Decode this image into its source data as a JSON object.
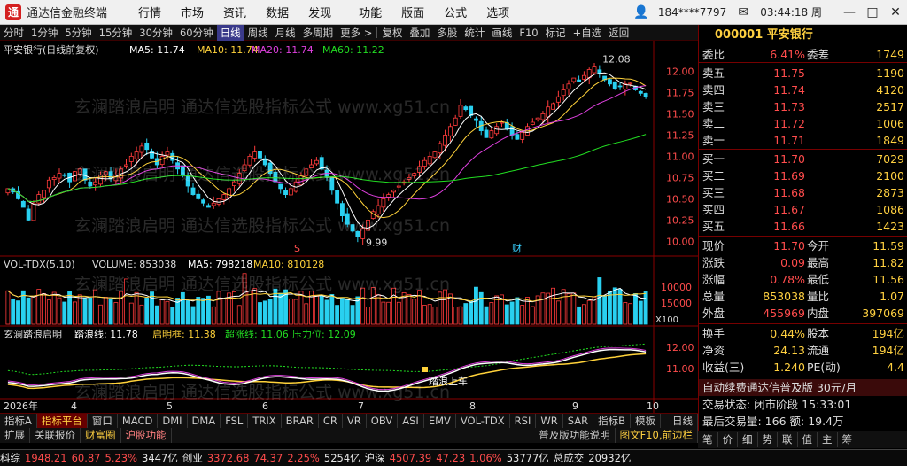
{
  "titlebar": {
    "app_title": "通达信金融终端",
    "menu": [
      "行情",
      "市场",
      "资讯",
      "数据",
      "发现",
      "功能",
      "版面",
      "公式",
      "选项"
    ],
    "user": "184****7797",
    "time": "03:44:18 周一"
  },
  "toolbar": {
    "period_tabs": [
      "分时",
      "1分钟",
      "5分钟",
      "15分钟",
      "30分钟",
      "60分钟",
      "日线",
      "周线",
      "月线",
      "多周期",
      "更多 >"
    ],
    "active_period": "日线",
    "tools": [
      "复权",
      "叠加",
      "多股",
      "统计",
      "画线",
      "F10",
      "标记",
      "+自选",
      "返回"
    ]
  },
  "price_panel": {
    "legend_stock": "平安银行(日线前复权)",
    "ma5_label": "MA5: 11.74",
    "ma10_label": "MA10: 11.74",
    "ma20_label": "MA20: 11.74",
    "ma60_label": "MA60: 11.22",
    "high_marker": "12.08",
    "low_marker": "9.99",
    "event_s": "S",
    "event_cai": "财",
    "y_ticks": [
      "12.00",
      "11.75",
      "11.50",
      "11.25",
      "11.00",
      "10.75",
      "10.50",
      "10.25",
      "10.00"
    ]
  },
  "volume_panel": {
    "legend_name": "VOL-TDX(5,10)",
    "legend_volume": "VOLUME: 853038",
    "legend_ma5": "MA5: 798218",
    "legend_ma10": "MA10: 810128",
    "y_ticks": [
      "15000",
      "10000"
    ],
    "unit": "X100"
  },
  "indicator_panel": {
    "legend_name": "玄澜踏浪启明",
    "legend_kangdai": "踏浪线: 11.78",
    "legend_qiming": "启明框: 11.38",
    "legend_chao": "超涨线: 11.06",
    "legend_yali": "压力位: 12.09",
    "signal_label": "踏浪上车",
    "y_ticks": [
      "12.00",
      "11.00"
    ]
  },
  "x_axis": {
    "labels": [
      "2026年",
      "4",
      "5",
      "6",
      "7",
      "8",
      "9",
      "10"
    ]
  },
  "quote": {
    "code_name": "000001 平安银行",
    "weibi_label": "委比",
    "weibi_value": "6.41%",
    "weicha_label": "委差",
    "weicha_value": "1749",
    "sells": [
      {
        "label": "卖五",
        "price": "11.75",
        "vol": "1190"
      },
      {
        "label": "卖四",
        "price": "11.74",
        "vol": "4120"
      },
      {
        "label": "卖三",
        "price": "11.73",
        "vol": "2517"
      },
      {
        "label": "卖二",
        "price": "11.72",
        "vol": "1006"
      },
      {
        "label": "卖一",
        "price": "11.71",
        "vol": "1849"
      }
    ],
    "buys": [
      {
        "label": "买一",
        "price": "11.70",
        "vol": "7029"
      },
      {
        "label": "买二",
        "price": "11.69",
        "vol": "2100"
      },
      {
        "label": "买三",
        "price": "11.68",
        "vol": "2873"
      },
      {
        "label": "买四",
        "price": "11.67",
        "vol": "1086"
      },
      {
        "label": "买五",
        "price": "11.66",
        "vol": "1423"
      }
    ],
    "stats": [
      {
        "l1": "现价",
        "v1": "11.70",
        "c1": "red",
        "l2": "今开",
        "v2": "11.59",
        "c2": "grn"
      },
      {
        "l1": "涨跌",
        "v1": "0.09",
        "c1": "red",
        "l2": "最高",
        "v2": "11.82",
        "c2": "red"
      },
      {
        "l1": "涨幅",
        "v1": "0.78%",
        "c1": "red",
        "l2": "最低",
        "v2": "11.56",
        "c2": "grn"
      },
      {
        "l1": "总量",
        "v1": "853038",
        "c1": "yel",
        "l2": "量比",
        "v2": "1.07",
        "c2": "red"
      },
      {
        "l1": "外盘",
        "v1": "455969",
        "c1": "red",
        "l2": "内盘",
        "v2": "397069",
        "c2": "grn"
      }
    ],
    "stats2": [
      {
        "l1": "换手",
        "v1": "0.44%",
        "c1": "yel",
        "l2": "股本",
        "v2": "194亿",
        "c2": "yel"
      },
      {
        "l1": "净资",
        "v1": "24.13",
        "c1": "yel",
        "l2": "流通",
        "v2": "194亿",
        "c2": "yel"
      },
      {
        "l1": "收益(三)",
        "v1": "1.240",
        "c1": "yel",
        "l2": "PE(动)",
        "v2": "4.4",
        "c2": "yel"
      }
    ],
    "promo": "自动续费通达信普及版 30元/月",
    "trade_state": "交易状态: 闭市阶段 15:33:01",
    "last_trade": "最后交易量: 166 额: 19.4万",
    "bottom_buttons": [
      "笔",
      "价",
      "细",
      "势",
      "联",
      "值",
      "主",
      "筹"
    ]
  },
  "tabs1": {
    "items": [
      "指标A",
      "指标平台",
      "窗口",
      "MACD",
      "DMI",
      "DMA",
      "FSL",
      "TRIX",
      "BRAR",
      "CR",
      "VR",
      "OBV",
      "ASI",
      "EMV",
      "VOL-TDX",
      "RSI",
      "WR",
      "SAR",
      "指标B",
      "模板"
    ],
    "active": "指标平台",
    "right_label": "日线"
  },
  "tabs2": {
    "items": [
      "扩展",
      "关联报价",
      "财富圈",
      "沪股功能"
    ],
    "right_items": [
      "普及版功能说明",
      "图文F10,前边栏"
    ]
  },
  "statusbar": {
    "items": [
      {
        "t": "科综",
        "c": "wht"
      },
      {
        "t": "1948.21",
        "c": "red"
      },
      {
        "t": "60.87",
        "c": "red"
      },
      {
        "t": "5.23%",
        "c": "red"
      },
      {
        "t": "3447亿",
        "c": "wht"
      },
      {
        "t": "创业",
        "c": "wht"
      },
      {
        "t": "3372.68",
        "c": "red"
      },
      {
        "t": "74.37",
        "c": "red"
      },
      {
        "t": "2.25%",
        "c": "red"
      },
      {
        "t": "5254亿",
        "c": "wht"
      },
      {
        "t": "沪深",
        "c": "wht"
      },
      {
        "t": "4507.39",
        "c": "red"
      },
      {
        "t": "47.23",
        "c": "red"
      },
      {
        "t": "1.06%",
        "c": "red"
      },
      {
        "t": "53777亿",
        "c": "wht"
      },
      {
        "t": "总成交",
        "c": "wht"
      },
      {
        "t": "20932亿",
        "c": "wht"
      }
    ]
  },
  "watermark": {
    "text": "玄澜踏浪启明 通达信选股指标公式 www.xg51.cn"
  },
  "colors": {
    "up": "#ff3b3b",
    "down": "#29d0f0",
    "ma5": "#ffffff",
    "ma10": "#ffd23a",
    "ma20": "#e040e0",
    "ma60": "#22dd22"
  },
  "chart_data": {
    "type": "candlestick",
    "x": [
      1,
      2,
      3,
      4,
      5,
      6,
      7,
      8,
      9,
      10,
      11,
      12,
      13,
      14,
      15,
      16,
      17,
      18,
      19,
      20,
      21,
      22,
      23,
      24,
      25,
      26,
      27,
      28,
      29,
      30,
      31,
      32,
      33,
      34,
      35,
      36,
      37,
      38,
      39,
      40,
      41,
      42,
      43,
      44,
      45,
      46,
      47,
      48,
      49,
      50,
      51,
      52,
      53,
      54,
      55,
      56,
      57,
      58,
      59,
      60,
      61,
      62,
      63,
      64,
      65,
      66,
      67,
      68,
      69,
      70,
      71,
      72,
      73,
      74,
      75,
      76,
      77,
      78,
      79,
      80,
      81,
      82,
      83,
      84,
      85,
      86,
      87,
      88,
      89,
      90,
      91,
      92,
      93,
      94,
      95,
      96,
      97,
      98,
      99,
      100,
      101,
      102,
      103,
      104,
      105,
      106,
      107,
      108,
      109,
      110,
      111,
      112,
      113,
      114,
      115,
      116,
      117,
      118,
      119,
      120,
      121,
      122,
      123,
      124,
      125,
      126,
      127,
      128,
      129,
      130,
      131,
      132,
      133,
      134,
      135,
      136,
      137,
      138,
      139,
      140,
      141,
      142,
      143,
      144,
      145,
      146,
      147,
      148,
      149,
      150,
      151,
      152,
      153,
      154,
      155,
      156,
      157,
      158,
      159,
      160,
      161,
      162,
      163,
      164,
      165,
      166,
      167,
      168,
      169,
      170,
      171,
      172,
      173,
      174,
      175,
      176,
      177,
      178,
      179
    ],
    "close": [
      10.62,
      10.58,
      10.5,
      10.4,
      10.25,
      10.45,
      10.55,
      10.6,
      10.72,
      10.75,
      10.8,
      10.78,
      10.7,
      10.82,
      10.85,
      10.72,
      10.65,
      10.7,
      10.78,
      10.82,
      10.74,
      10.78,
      10.85,
      10.9,
      11.0,
      11.05,
      11.12,
      11.08,
      10.98,
      10.9,
      11.0,
      11.05,
      10.95,
      10.85,
      10.78,
      10.65,
      10.55,
      10.5,
      10.45,
      10.4,
      10.45,
      10.5,
      10.55,
      10.62,
      10.7,
      10.8,
      10.9,
      11.0,
      11.05,
      10.98,
      10.9,
      10.8,
      10.7,
      10.62,
      10.55,
      10.62,
      10.7,
      10.78,
      10.85,
      10.9,
      10.95,
      10.85,
      10.75,
      10.6,
      10.45,
      10.3,
      10.2,
      10.12,
      10.05,
      10.15,
      10.25,
      10.35,
      10.42,
      10.5,
      10.55,
      10.6,
      10.65,
      10.7,
      10.75,
      10.8,
      10.88,
      10.95,
      11.0,
      11.05,
      11.15,
      11.25,
      11.35,
      11.45,
      11.6,
      11.55,
      11.48,
      11.42,
      11.3,
      11.22,
      11.3,
      11.35,
      11.4,
      11.32,
      11.25,
      11.2,
      11.28,
      11.35,
      11.4,
      11.45,
      11.5,
      11.58,
      11.62,
      11.7,
      11.78,
      11.85,
      11.92,
      11.88,
      11.95,
      12.02,
      12.05,
      11.98,
      11.9,
      11.85,
      11.8,
      11.82,
      11.85,
      11.86,
      11.78,
      11.74,
      11.7
    ],
    "series": [
      {
        "name": "MA5",
        "values": [
          11.74
        ]
      },
      {
        "name": "MA10",
        "values": [
          11.74
        ]
      },
      {
        "name": "MA20",
        "values": [
          11.74
        ]
      },
      {
        "name": "MA60",
        "values": [
          11.22
        ]
      }
    ],
    "ylim": [
      9.9,
      12.15
    ],
    "high_point": 12.08,
    "low_point": 9.99,
    "volume_ylim": [
      0,
      18000
    ]
  }
}
